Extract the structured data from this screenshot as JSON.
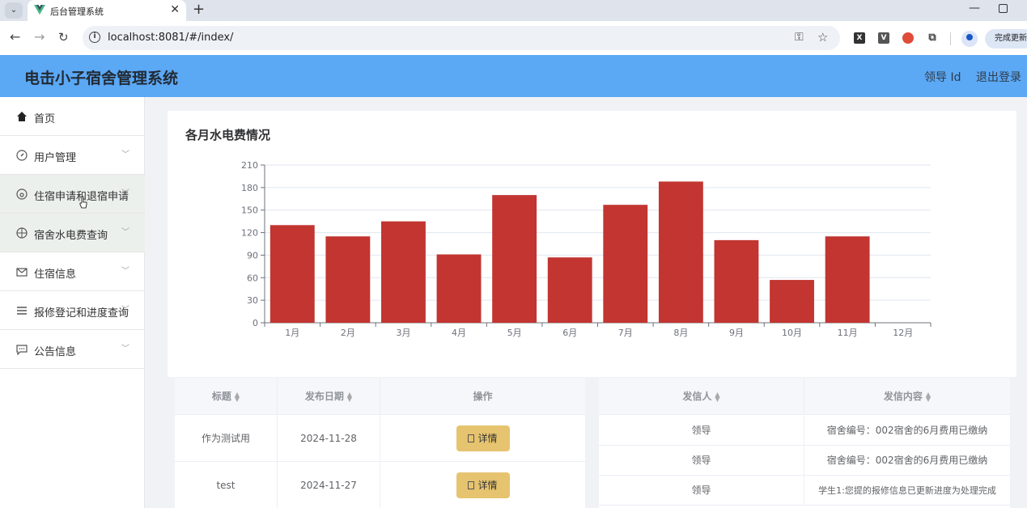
{
  "browser": {
    "tab_title": "后台管理系统",
    "url": "localhost:8081/#/index/",
    "update_label": "完成更新"
  },
  "header": {
    "title": "电击小子宿舍管理系统",
    "user_label": "领导 Id",
    "logout_label": "退出登录"
  },
  "sidebar": {
    "items": [
      {
        "label": "首页",
        "icon": "home-icon"
      },
      {
        "label": "用户管理",
        "icon": "compass-icon"
      },
      {
        "label": "住宿申请和退宿申请",
        "icon": "gauge-icon"
      },
      {
        "label": "宿舍水电费查询",
        "icon": "crosshair-icon"
      },
      {
        "label": "住宿信息",
        "icon": "mail-icon"
      },
      {
        "label": "报修登记和进度查询",
        "icon": "list-icon"
      },
      {
        "label": "公告信息",
        "icon": "chat-icon"
      }
    ]
  },
  "chart_data": {
    "type": "bar",
    "title": "各月水电费情况",
    "categories": [
      "1月",
      "2月",
      "3月",
      "4月",
      "5月",
      "6月",
      "7月",
      "8月",
      "9月",
      "10月",
      "11月",
      "12月"
    ],
    "values": [
      130,
      115,
      135,
      91,
      170,
      87,
      157,
      188,
      110,
      57,
      115,
      0
    ],
    "ylim": [
      0,
      210
    ],
    "yticks": [
      0,
      30,
      60,
      90,
      120,
      150,
      180,
      210
    ],
    "grid": true,
    "color": "#c23531"
  },
  "notices_table": {
    "columns": [
      "标题",
      "发布日期",
      "操作"
    ],
    "rows": [
      {
        "title": "作为测试用",
        "date": "2024-11-28",
        "action": "详情"
      },
      {
        "title": "test",
        "date": "2024-11-27",
        "action": "详情"
      }
    ]
  },
  "messages_table": {
    "columns": [
      "发信人",
      "发信内容"
    ],
    "rows": [
      {
        "sender": "领导",
        "content": "宿舍编号：002宿舍的6月费用已缴纳"
      },
      {
        "sender": "领导",
        "content": "宿舍编号：002宿舍的6月费用已缴纳"
      },
      {
        "sender": "领导",
        "content": "学生1:您提的报修信息已更新进度为处理完成"
      }
    ]
  }
}
